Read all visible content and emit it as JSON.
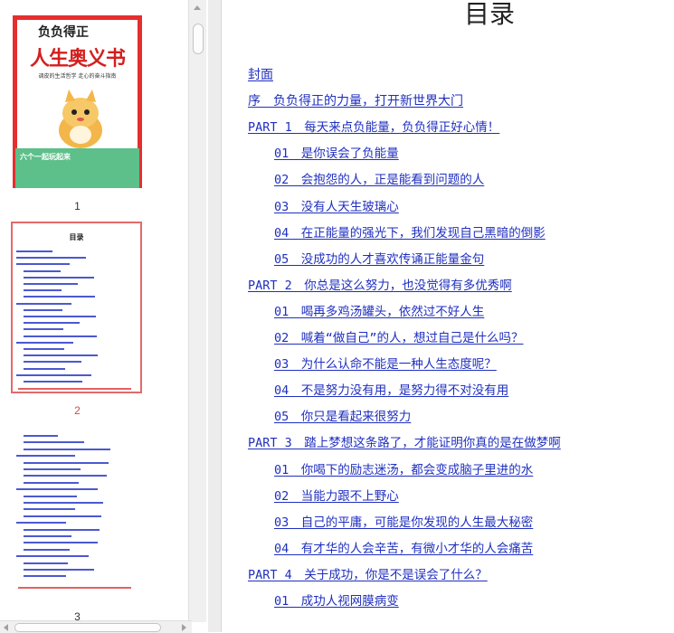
{
  "sidebar": {
    "pages": [
      {
        "number": "1",
        "kind": "cover"
      },
      {
        "number": "2",
        "kind": "toc",
        "active": true
      },
      {
        "number": "3",
        "kind": "content"
      }
    ],
    "cover": {
      "title_top": "负负得正",
      "title_main": "人生奥义书",
      "subtitle": "调皮的生活哲学 走心的奋斗指南",
      "green_text": "六个一起玩起来"
    },
    "toc_mini_title": "目录"
  },
  "document": {
    "title": "目录",
    "entries": [
      {
        "text": "封面",
        "level": 0,
        "mono": false
      },
      {
        "text": "序　负负得正的力量，打开新世界大门",
        "level": 0,
        "mono": false
      },
      {
        "text": "PART 1　每天来点负能量，负负得正好心情！",
        "level": 0,
        "mono": true
      },
      {
        "text": "01　是你误会了负能量",
        "level": 1,
        "mono": true
      },
      {
        "text": "02　会抱怨的人，正是能看到问题的人",
        "level": 1,
        "mono": true
      },
      {
        "text": "03　没有人天生玻璃心",
        "level": 1,
        "mono": true
      },
      {
        "text": "04　在正能量的强光下，我们发现自己黑暗的倒影",
        "level": 1,
        "mono": true
      },
      {
        "text": "05　没成功的人才喜欢传诵正能量金句",
        "level": 1,
        "mono": true
      },
      {
        "text": "PART 2　你总是这么努力，也没觉得有多优秀啊",
        "level": 0,
        "mono": true
      },
      {
        "text": "01　喝再多鸡汤罐头，依然过不好人生",
        "level": 1,
        "mono": true
      },
      {
        "text": "02　喊着“做自己”的人，想过自己是什么吗？",
        "level": 1,
        "mono": true
      },
      {
        "text": "03　为什么认命不能是一种人生态度呢？",
        "level": 1,
        "mono": true
      },
      {
        "text": "04　不是努力没有用，是努力得不对没有用",
        "level": 1,
        "mono": true
      },
      {
        "text": "05　你只是看起来很努力",
        "level": 1,
        "mono": true
      },
      {
        "text": "PART 3　踏上梦想这条路了，才能证明你真的是在做梦啊",
        "level": 0,
        "mono": true
      },
      {
        "text": "01　你喝下的励志迷汤，都会变成脑子里进的水",
        "level": 1,
        "mono": true
      },
      {
        "text": "02　当能力跟不上野心",
        "level": 1,
        "mono": true
      },
      {
        "text": "03　自己的平庸，可能是你发现的人生最大秘密",
        "level": 1,
        "mono": true
      },
      {
        "text": "04　有才华的人会辛苦，有微小才华的人会痛苦",
        "level": 1,
        "mono": true
      },
      {
        "text": "PART 4　关于成功，你是不是误会了什么？",
        "level": 0,
        "mono": true
      },
      {
        "text": "01　成功人视网膜病变",
        "level": 1,
        "mono": true
      }
    ]
  },
  "colors": {
    "link": "#1f2fbf",
    "active_thumb_border": "#e36a6a",
    "cover_red": "#e62e2e",
    "cover_green": "#5dbf8a"
  }
}
